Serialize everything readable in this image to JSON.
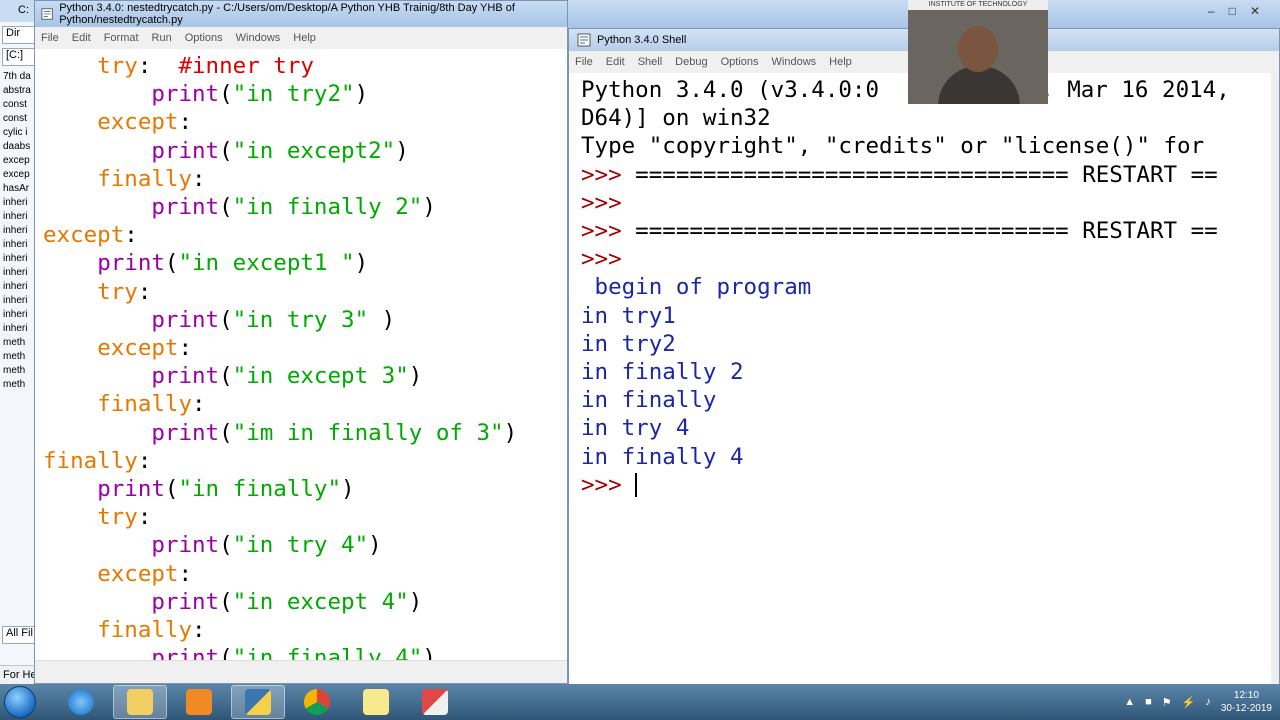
{
  "background_explorer": {
    "top_label": "C:",
    "box1": "Dir",
    "box2": "[C:]",
    "files": [
      "7th da",
      "abstra",
      "const",
      "const",
      "cylic i",
      "daabs",
      "excep",
      "excep",
      "hasAr",
      "inheri",
      "inheri",
      "inheri",
      "inheri",
      "inheri",
      "inheri",
      "inheri",
      "inheri",
      "inheri",
      "inheri",
      "meth",
      "meth",
      "meth",
      "meth"
    ],
    "all_files": "All Fil",
    "status": "For He"
  },
  "editor": {
    "title": "Python 3.4.0: nestedtrycatch.py - C:/Users/om/Desktop/A Python YHB Trainig/8th Day YHB of Python/nestedtrycatch.py",
    "menu": [
      "File",
      "Edit",
      "Format",
      "Run",
      "Options",
      "Windows",
      "Help"
    ]
  },
  "shell": {
    "title": "Python 3.4.0 Shell",
    "menu": [
      "File",
      "Edit",
      "Shell",
      "Debug",
      "Options",
      "Windows",
      "Help"
    ],
    "banner1": "Python 3.4.0 (v3.4.0:0",
    "banner1b": "13, Mar 16 2014,",
    "banner2": "D64)] on win32",
    "banner3": "Type \"copyright\", \"credits\" or \"license()\" for",
    "prompt": ">>>",
    "restart_line": " ================================ RESTART ==",
    "output": [
      " begin of program",
      "in try1",
      "in try2",
      "in finally 2",
      "in finally",
      "in try 4",
      "in finally 4"
    ]
  },
  "webcam": {
    "sign_text": "INSTITUTE OF TECHNOLOGY"
  },
  "taskbar": {
    "time": "12:10",
    "date": "30-12-2019"
  },
  "colors": {
    "keyword": "#e67700",
    "string": "#00aa00",
    "builtin": "#9b00a8",
    "comment": "#dd0000",
    "output": "#1b27a6",
    "prompt": "#a00000"
  }
}
